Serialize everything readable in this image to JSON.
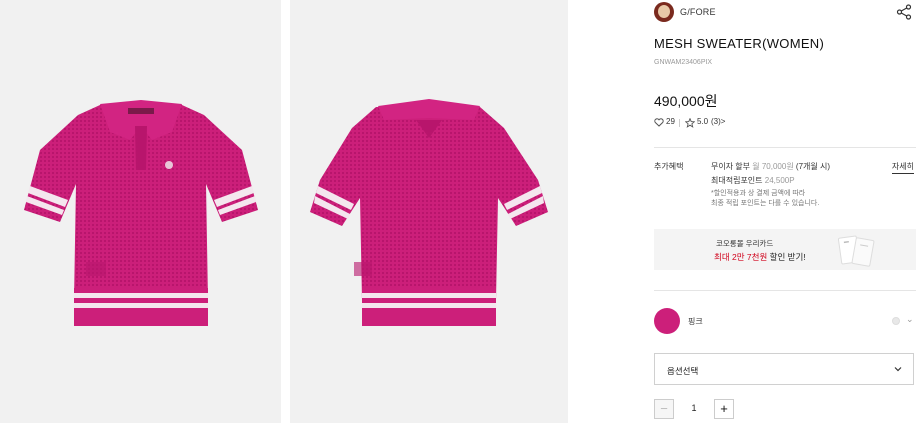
{
  "brand": {
    "name": "G/FORE"
  },
  "product": {
    "title": "MESH SWEATER(WOMEN)",
    "code": "GNWAM23406PIX",
    "price": "490,000원",
    "likes": "29",
    "rating": "5.0",
    "review_count": "(3)>"
  },
  "benefits": {
    "label": "추가혜택",
    "installment_prefix": "무이자 할부",
    "installment": "월 70,000원",
    "installment_note": "(7개월 시)",
    "points_label": "최대적립포인트",
    "points_value": "24,500P",
    "note_line1": "*할인적용과 상 결제 금액에 따라",
    "note_line2": "최종 적립 포인트는 다를 수 있습니다.",
    "detail_link": "자세히"
  },
  "card_banner": {
    "line1": "코오롱몰 우리카드",
    "line2_prefix": "최대 2만 7천원",
    "line2_suffix": " 할인 받기!"
  },
  "color_option": {
    "label": "핑크",
    "swatch_color": "#cc1f7a"
  },
  "option_select": {
    "value": "옵션선택"
  },
  "quantity": {
    "value": "1",
    "minus": "−",
    "plus": "+"
  },
  "icons": [
    "share-icon",
    "heart-icon",
    "star-icon",
    "chevron-down-icon"
  ],
  "colors": {
    "garment": "#cc1f7a",
    "stripe": "#f4e6ee",
    "discount_red": "#d0021b"
  }
}
